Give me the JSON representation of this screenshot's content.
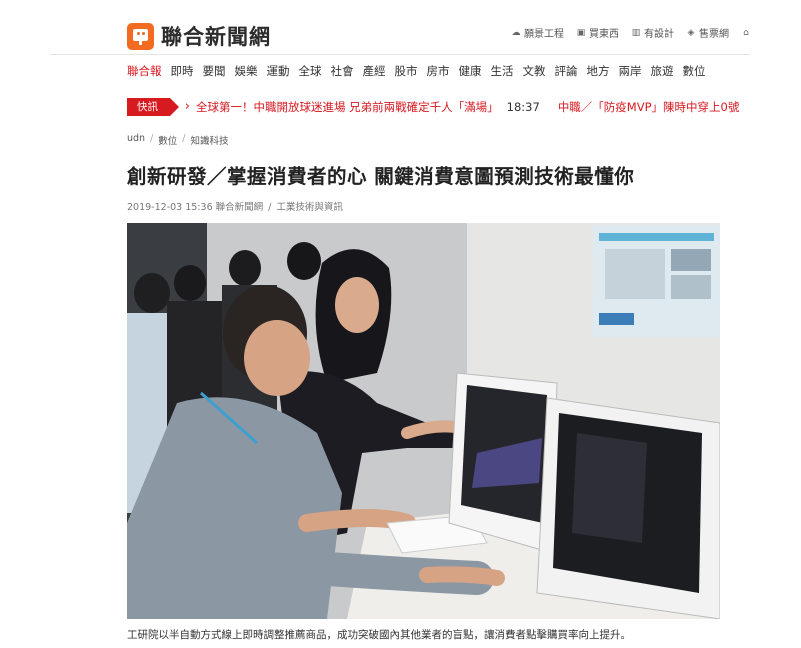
{
  "brand": {
    "name": "聯合新聞網",
    "logo_color": "#f26b21"
  },
  "services": [
    {
      "icon": "landscape-icon",
      "label": "願景工程"
    },
    {
      "icon": "cart-icon",
      "label": "買東西"
    },
    {
      "icon": "design-icon",
      "label": "有設計"
    },
    {
      "icon": "tag-icon",
      "label": "售票網"
    },
    {
      "icon": "more-icon",
      "label": ""
    }
  ],
  "nav": [
    "聯合報",
    "即時",
    "要聞",
    "娛樂",
    "運動",
    "全球",
    "社會",
    "產經",
    "股市",
    "房市",
    "健康",
    "生活",
    "文教",
    "評論",
    "地方",
    "兩岸",
    "旅遊",
    "數位"
  ],
  "ticker": {
    "badge": "快訊",
    "items": [
      {
        "headline": "全球第一！中職開放球迷進場 兄弟前兩戰確定千人「滿場」",
        "time": "18:37"
      },
      {
        "headline": "中職／「防疫MVP」陳時中穿上0號",
        "time": ""
      }
    ]
  },
  "breadcrumb": [
    "udn",
    "數位",
    "知識科技"
  ],
  "article": {
    "title": "創新研發／掌握消費者的心 關鍵消費意圖預測技術最懂你",
    "datetime": "2019-12-03 15:36",
    "source": "聯合新聞網",
    "author": "工業技術與資訊",
    "caption": "工研院以半自動方式線上即時調整推薦商品，成功突破國內其他業者的盲點，讓消費者點擊購買率向上提升。"
  },
  "colors": {
    "accent": "#d71920",
    "text": "#222222"
  }
}
